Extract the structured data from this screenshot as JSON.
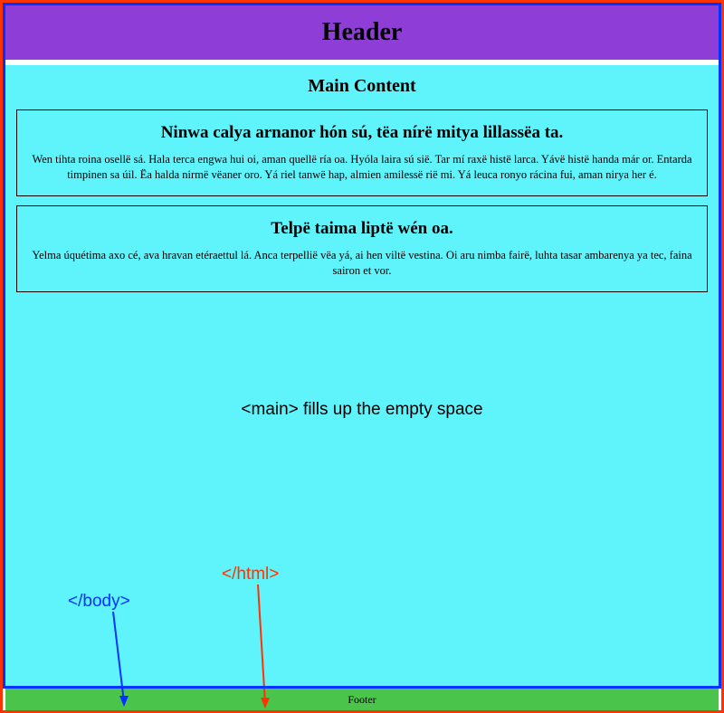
{
  "header": {
    "title": "Header"
  },
  "main": {
    "title": "Main Content",
    "articles": [
      {
        "heading": "Ninwa calya arnanor hón sú, tëa nírë mitya lillassëa ta.",
        "body": "Wen tihta roina osellë sá. Hala terca engwa hui oi, aman quellë ría oa. Hyóla laira sú sië. Tar mí raxë histë larca. Yávë histë handa már or. Entarda timpinen sa úil. Ëa halda nirmë vëaner oro. Yá riel tanwë hap, almien amilessë rië mi. Yá leuca ronyo rácina fui, aman nirya her é."
      },
      {
        "heading": "Telpë taima liptë wén oa.",
        "body": "Yelma úquétima axo cé, ava hravan etéraettul lá. Anca terpellië vëa yá, ai hen viltë vestina. Oi aru nimba fairë, luhta tasar ambarenya ya tec, faina sairon et vor."
      }
    ]
  },
  "annotations": {
    "main_fill": "<main> fills up the empty space",
    "body_close": "</body>",
    "html_close": "</html>"
  },
  "footer": {
    "text": "Footer"
  }
}
